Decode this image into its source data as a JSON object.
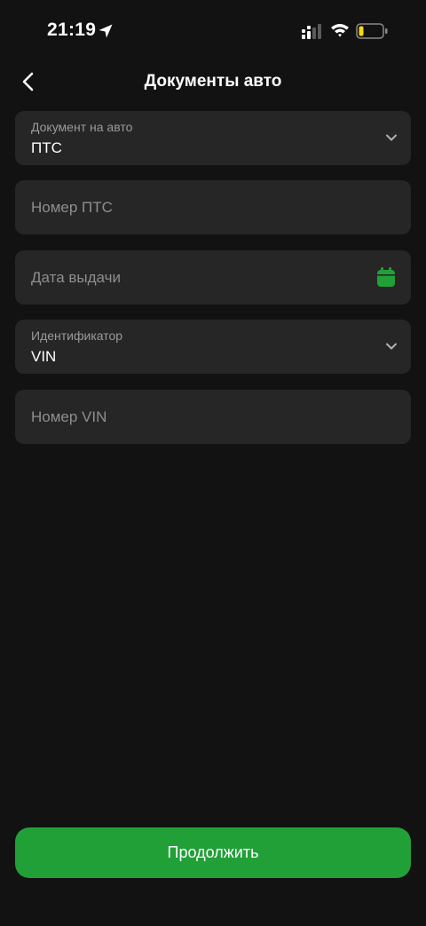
{
  "status_bar": {
    "time": "21:19",
    "icons": [
      "location-arrow-icon",
      "cellular-signal-icon",
      "wifi-icon",
      "battery-low-icon"
    ],
    "battery_color": "#f5d90a"
  },
  "header": {
    "title": "Документы авто",
    "back_icon": "chevron-left-icon"
  },
  "fields": {
    "document": {
      "label": "Документ на авто",
      "value": "ПТС"
    },
    "pts_number": {
      "placeholder": "Номер ПТС"
    },
    "issue_date": {
      "placeholder": "Дата выдачи",
      "icon": "calendar-icon"
    },
    "identifier": {
      "label": "Идентификатор",
      "value": "VIN"
    },
    "vin_number": {
      "placeholder": "Номер VIN"
    }
  },
  "actions": {
    "continue_label": "Продолжить"
  },
  "colors": {
    "background": "#121212",
    "field_background": "#262626",
    "accent": "#21a038",
    "placeholder": "#8e8e8e",
    "label": "#9a9a9a"
  }
}
